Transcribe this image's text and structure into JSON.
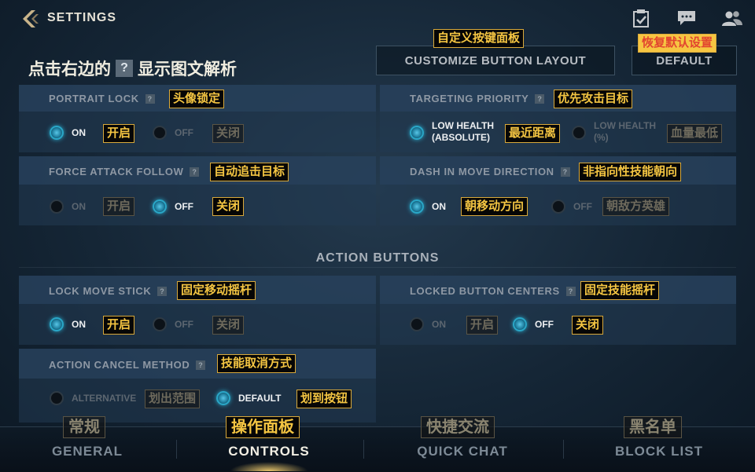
{
  "header": {
    "title": "SETTINGS",
    "hint": "点击右边的",
    "hint_after": "显示图文解析",
    "hint_qmark": "?"
  },
  "buttons": {
    "customize_label": "CUSTOMIZE BUTTON LAYOUT",
    "customize_anno": "自定义按键面板",
    "default_label": "DEFAULT",
    "default_anno": "恢复默认设置"
  },
  "panels": {
    "portrait_lock": {
      "title": "PORTRAIT LOCK",
      "anno": "头像锁定",
      "on_label": "ON",
      "on_anno": "开启",
      "off_label": "OFF",
      "off_anno": "关闭"
    },
    "targeting_priority": {
      "title": "TARGETING PRIORITY",
      "anno": "优先攻击目标",
      "opt1_line1": "LOW HEALTH",
      "opt1_line2": "(ABSOLUTE)",
      "opt1_anno": "最近距离",
      "opt2_line1": "LOW HEALTH",
      "opt2_line2": "(%)",
      "opt2_anno": "血量最低"
    },
    "force_attack_follow": {
      "title": "FORCE ATTACK FOLLOW",
      "anno": "自动追击目标",
      "on_label": "ON",
      "on_anno": "开启",
      "off_label": "OFF",
      "off_anno": "关闭"
    },
    "dash_in_move_direction": {
      "title": "DASH IN MOVE DIRECTION",
      "anno": "非指向性技能朝向",
      "on_label": "ON",
      "on_anno": "朝移动方向",
      "off_label": "OFF",
      "off_anno": "朝敌方英雄"
    },
    "section_title": "ACTION BUTTONS",
    "lock_move_stick": {
      "title": "LOCK MOVE STICK",
      "anno": "固定移动摇杆",
      "on_label": "ON",
      "on_anno": "开启",
      "off_label": "OFF",
      "off_anno": "关闭"
    },
    "locked_button_centers": {
      "title": "LOCKED BUTTON CENTERS",
      "anno": "固定技能摇杆",
      "on_label": "ON",
      "on_anno": "开启",
      "off_label": "OFF",
      "off_anno": "关闭"
    },
    "action_cancel_method": {
      "title": "ACTION CANCEL METHOD",
      "anno": "技能取消方式",
      "opt1_label": "ALTERNATIVE",
      "opt1_anno": "划出范围",
      "opt2_label": "DEFAULT",
      "opt2_anno": "划到按钮"
    }
  },
  "bottom_nav": {
    "tabs": [
      {
        "label": "GENERAL",
        "anno": "常规"
      },
      {
        "label": "CONTROLS",
        "anno": "操作面板"
      },
      {
        "label": "QUICK CHAT",
        "anno": "快捷交流"
      },
      {
        "label": "BLOCK LIST",
        "anno": "黑名单"
      }
    ],
    "active_index": 1
  },
  "colors": {
    "accent": "#2aa7c8",
    "annotation_text": "#f4c542",
    "annotation_border": "#d9a93a",
    "background": "#152636"
  },
  "icons": [
    "back-chevron-icon",
    "checklist-icon",
    "chat-icon",
    "friends-icon",
    "question-icon"
  ]
}
